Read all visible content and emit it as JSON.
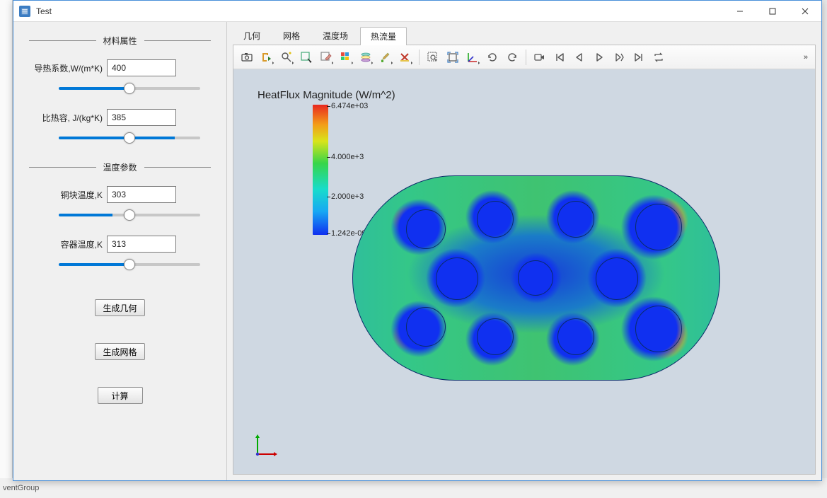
{
  "window": {
    "title": "Test",
    "footer_behind": "ventGroup"
  },
  "sidebar": {
    "group1_title": "材料属性",
    "thermal_cond_label": "导热系数,W/(m*K)",
    "thermal_cond_value": "400",
    "spec_heat_label": "比热容, J/(kg*K)",
    "spec_heat_value": "385",
    "group2_title": "温度参数",
    "copper_temp_label": "铜块温度,K",
    "copper_temp_value": "303",
    "vessel_temp_label": "容器温度,K",
    "vessel_temp_value": "313",
    "btn_geom": "生成几何",
    "btn_mesh": "生成网格",
    "btn_calc": "计算"
  },
  "tabs": {
    "items": [
      {
        "label": "几何"
      },
      {
        "label": "网格"
      },
      {
        "label": "温度场"
      },
      {
        "label": "热流量"
      }
    ],
    "active_index": 3
  },
  "toolbar_icons": [
    "camera",
    "export",
    "find",
    "box-select",
    "edit-color",
    "grid",
    "layers",
    "brush",
    "delete-x",
    "",
    "marquee",
    "fit",
    "axes",
    "rotate-ccw",
    "rotate-cw",
    "",
    "record",
    "first",
    "prev",
    "play",
    "next-frame",
    "last",
    "loop"
  ],
  "canvas": {
    "plot_title": "HeatFlux Magnitude (W/m^2)",
    "legend": {
      "max": "6.474e+03",
      "mid1": "4.000e+3",
      "mid2": "2.000e+3",
      "min": "1.242e-09"
    }
  },
  "chart_data": {
    "type": "heatmap",
    "title": "HeatFlux Magnitude (W/m^2)",
    "quantity": "HeatFlux Magnitude",
    "unit": "W/m^2",
    "colorbar": {
      "min": 1.242e-09,
      "max": 6474,
      "ticks": [
        1.242e-09,
        2000,
        4000,
        6474
      ],
      "tick_labels": [
        "1.242e-09",
        "2.000e+3",
        "4.000e+3",
        "6.474e+03"
      ],
      "colormap": "rainbow (blue→cyan→green→yellow→orange→red)"
    },
    "domain_description": "2D stadium/capsule-shaped container with 11 circular copper inserts; high heat-flux hotspots near the outermost inserts at the rounded ends, low flux in the interior around inserts."
  }
}
